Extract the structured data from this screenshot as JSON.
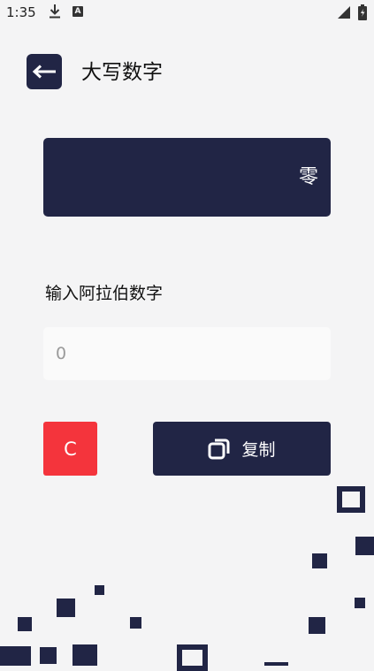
{
  "status_bar": {
    "time": "1:35",
    "a_badge": "A"
  },
  "header": {
    "title": "大写数字",
    "back_icon": "arrow-left-icon"
  },
  "result": {
    "text": "零"
  },
  "input": {
    "label": "输入阿拉伯数字",
    "placeholder": "0",
    "value": ""
  },
  "buttons": {
    "clear_label": "C",
    "copy_label": "复制",
    "copy_icon": "copy-icon"
  },
  "colors": {
    "primary": "#212545",
    "danger": "#f4343c",
    "background": "#f4f4f5",
    "input_bg": "#fafafa"
  }
}
